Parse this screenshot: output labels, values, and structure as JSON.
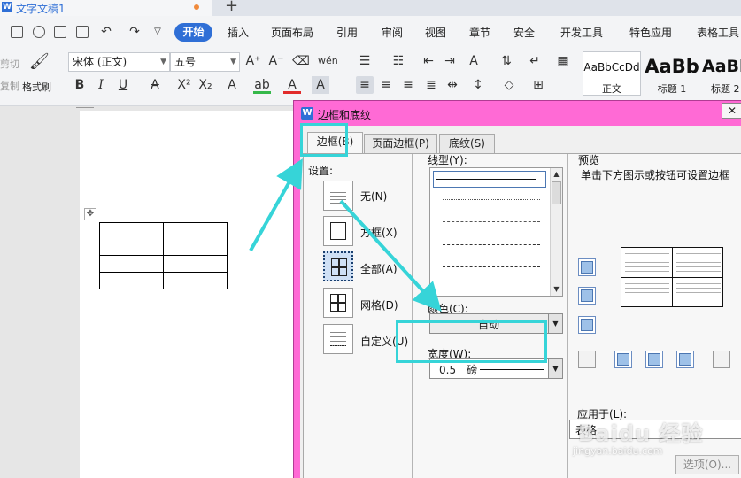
{
  "doc_tab": {
    "title": "文字文稿1"
  },
  "menu": {
    "tabs": [
      "开始",
      "插入",
      "页面布局",
      "引用",
      "审阅",
      "视图",
      "章节",
      "安全",
      "开发工具",
      "特色应用",
      "表格工具"
    ]
  },
  "ribbon": {
    "cut_label": "剪切",
    "copy_label": "复制",
    "format_painter_label": "格式刷",
    "font_name": "宋体 (正文)",
    "font_size": "五号",
    "styles": [
      {
        "sample": "AaBbCcDd",
        "name": "正文"
      },
      {
        "sample": "AaBb",
        "name": "标题 1"
      },
      {
        "sample": "AaBl",
        "name": "标题 2"
      }
    ]
  },
  "dialog": {
    "title": "边框和底纹",
    "tabs": [
      "边框(B)",
      "页面边框(P)",
      "底纹(S)"
    ],
    "settings_label": "设置:",
    "settings": [
      "无(N)",
      "方框(X)",
      "全部(A)",
      "网格(D)",
      "自定义(U)"
    ],
    "line_style_label": "线型(Y):",
    "color_label": "颜色(C):",
    "color_value": "自动",
    "width_label": "宽度(W):",
    "width_value": "0.5　磅",
    "preview_label": "预览",
    "preview_hint": "单击下方图示或按钮可设置边框",
    "apply_to_label": "应用于(L):",
    "apply_to_value": "表格",
    "options_button": "选项(O)..."
  },
  "watermark": {
    "brand": "Baidu 经验",
    "url": "jingyan.baidu.com"
  },
  "colors": {
    "accent_blue": "#2f6fd6",
    "dialog_frame": "#ff6ad5",
    "highlight_cyan": "#36d4d8"
  }
}
